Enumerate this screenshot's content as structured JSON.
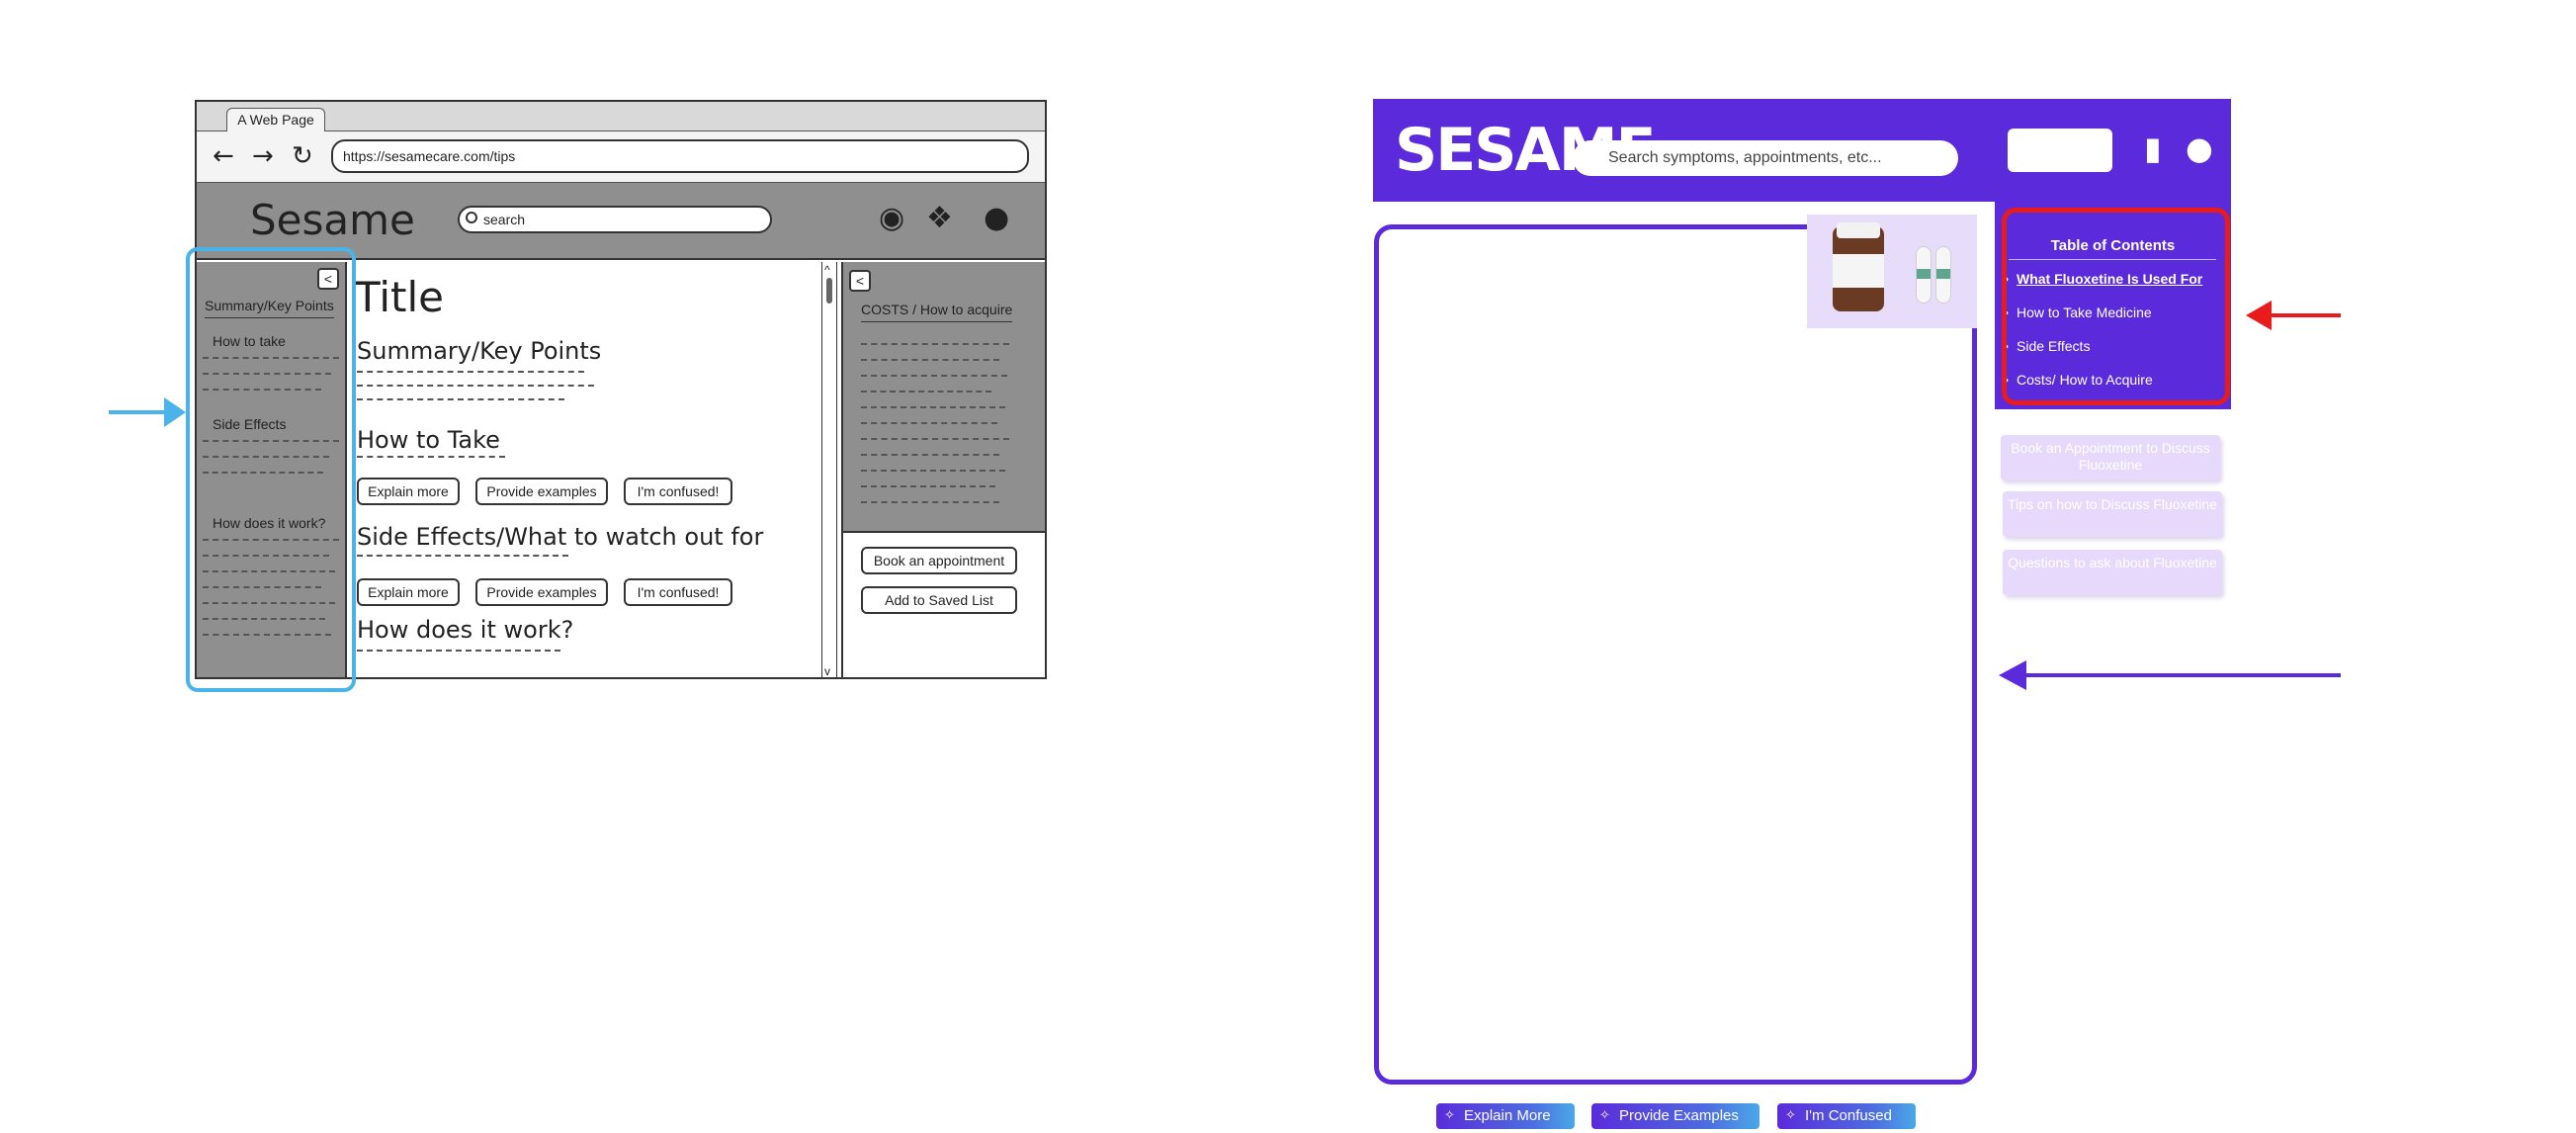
{
  "wireframe": {
    "tab_title": "A Web Page",
    "nav": {
      "back_icon": "←",
      "forward_icon": "→",
      "reload_icon": "↻"
    },
    "url": "https://sesamecare.com/tips",
    "logo": "Sesame",
    "search_placeholder": "search",
    "header_icons": {
      "eye": "◉",
      "bookmark": "❖",
      "user": "●"
    },
    "collapse_label": "<",
    "left_panel": {
      "title": "Summary/Key Points",
      "sections": [
        "How to take",
        "Side Effects",
        "How does it work?"
      ]
    },
    "main": {
      "title": "Title",
      "sections": [
        {
          "heading": "Summary/Key Points"
        },
        {
          "heading": "How to Take"
        },
        {
          "heading": "Side Effects/What to watch out for"
        },
        {
          "heading": "How does it work?"
        }
      ],
      "buttons": {
        "explain": "Explain more",
        "examples": "Provide examples",
        "confused": "I'm confused!"
      }
    },
    "scroll": {
      "up": "^",
      "down": "v"
    },
    "right_panel": {
      "title": "COSTS /  How to acquire",
      "buttons": [
        "Book an appointment",
        "Add to Saved List"
      ]
    }
  },
  "hifi": {
    "logo": "SESAME",
    "search_placeholder": "Search symptoms, appointments, etc...",
    "icons": {
      "bookmark": "▮",
      "user": "●"
    },
    "toc": {
      "title": "Table of Contents",
      "items": [
        "What Fluoxetine Is Used For",
        "How to Take Medicine",
        "Side Effects",
        "Costs/ How to Acquire"
      ]
    },
    "side_buttons": [
      "Book an Appointment to Discuss Fluoxetine",
      "Tips on how to Discuss Fluoxetine",
      "Questions to ask about Fluoxetine"
    ],
    "ai_buttons": [
      "Explain More",
      "Provide Examples",
      "I'm Confused"
    ],
    "spark_icon": "✧",
    "colors": {
      "brand": "#5b2bdb",
      "highlight_red": "#e81c1c",
      "highlight_blue": "#4ab4ea"
    }
  }
}
